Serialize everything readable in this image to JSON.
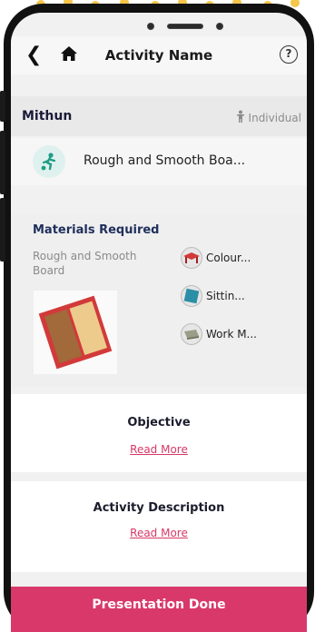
{
  "colors": {
    "accent": "#d9386b",
    "link": "#d63866",
    "heading": "#1f2f5c"
  },
  "header": {
    "title": "Activity Name",
    "back_icon": "chevron-left-icon",
    "home_icon": "home-icon",
    "help_label": "?"
  },
  "student": {
    "name": "Mithun",
    "mode_label": "Individual",
    "mode_icon": "person-icon"
  },
  "activity": {
    "name": "Rough and Smooth Boa..."
  },
  "materials": {
    "title": "Materials Required",
    "description": "Rough and Smooth Board",
    "items": [
      {
        "label": "Colour..."
      },
      {
        "label": "Sittin..."
      },
      {
        "label": "Work M..."
      }
    ]
  },
  "objective": {
    "title": "Objective",
    "link_label": "Read More"
  },
  "description": {
    "title": "Activity Description",
    "link_label": "Read More"
  },
  "footer": {
    "button_label": "Presentation Done"
  }
}
